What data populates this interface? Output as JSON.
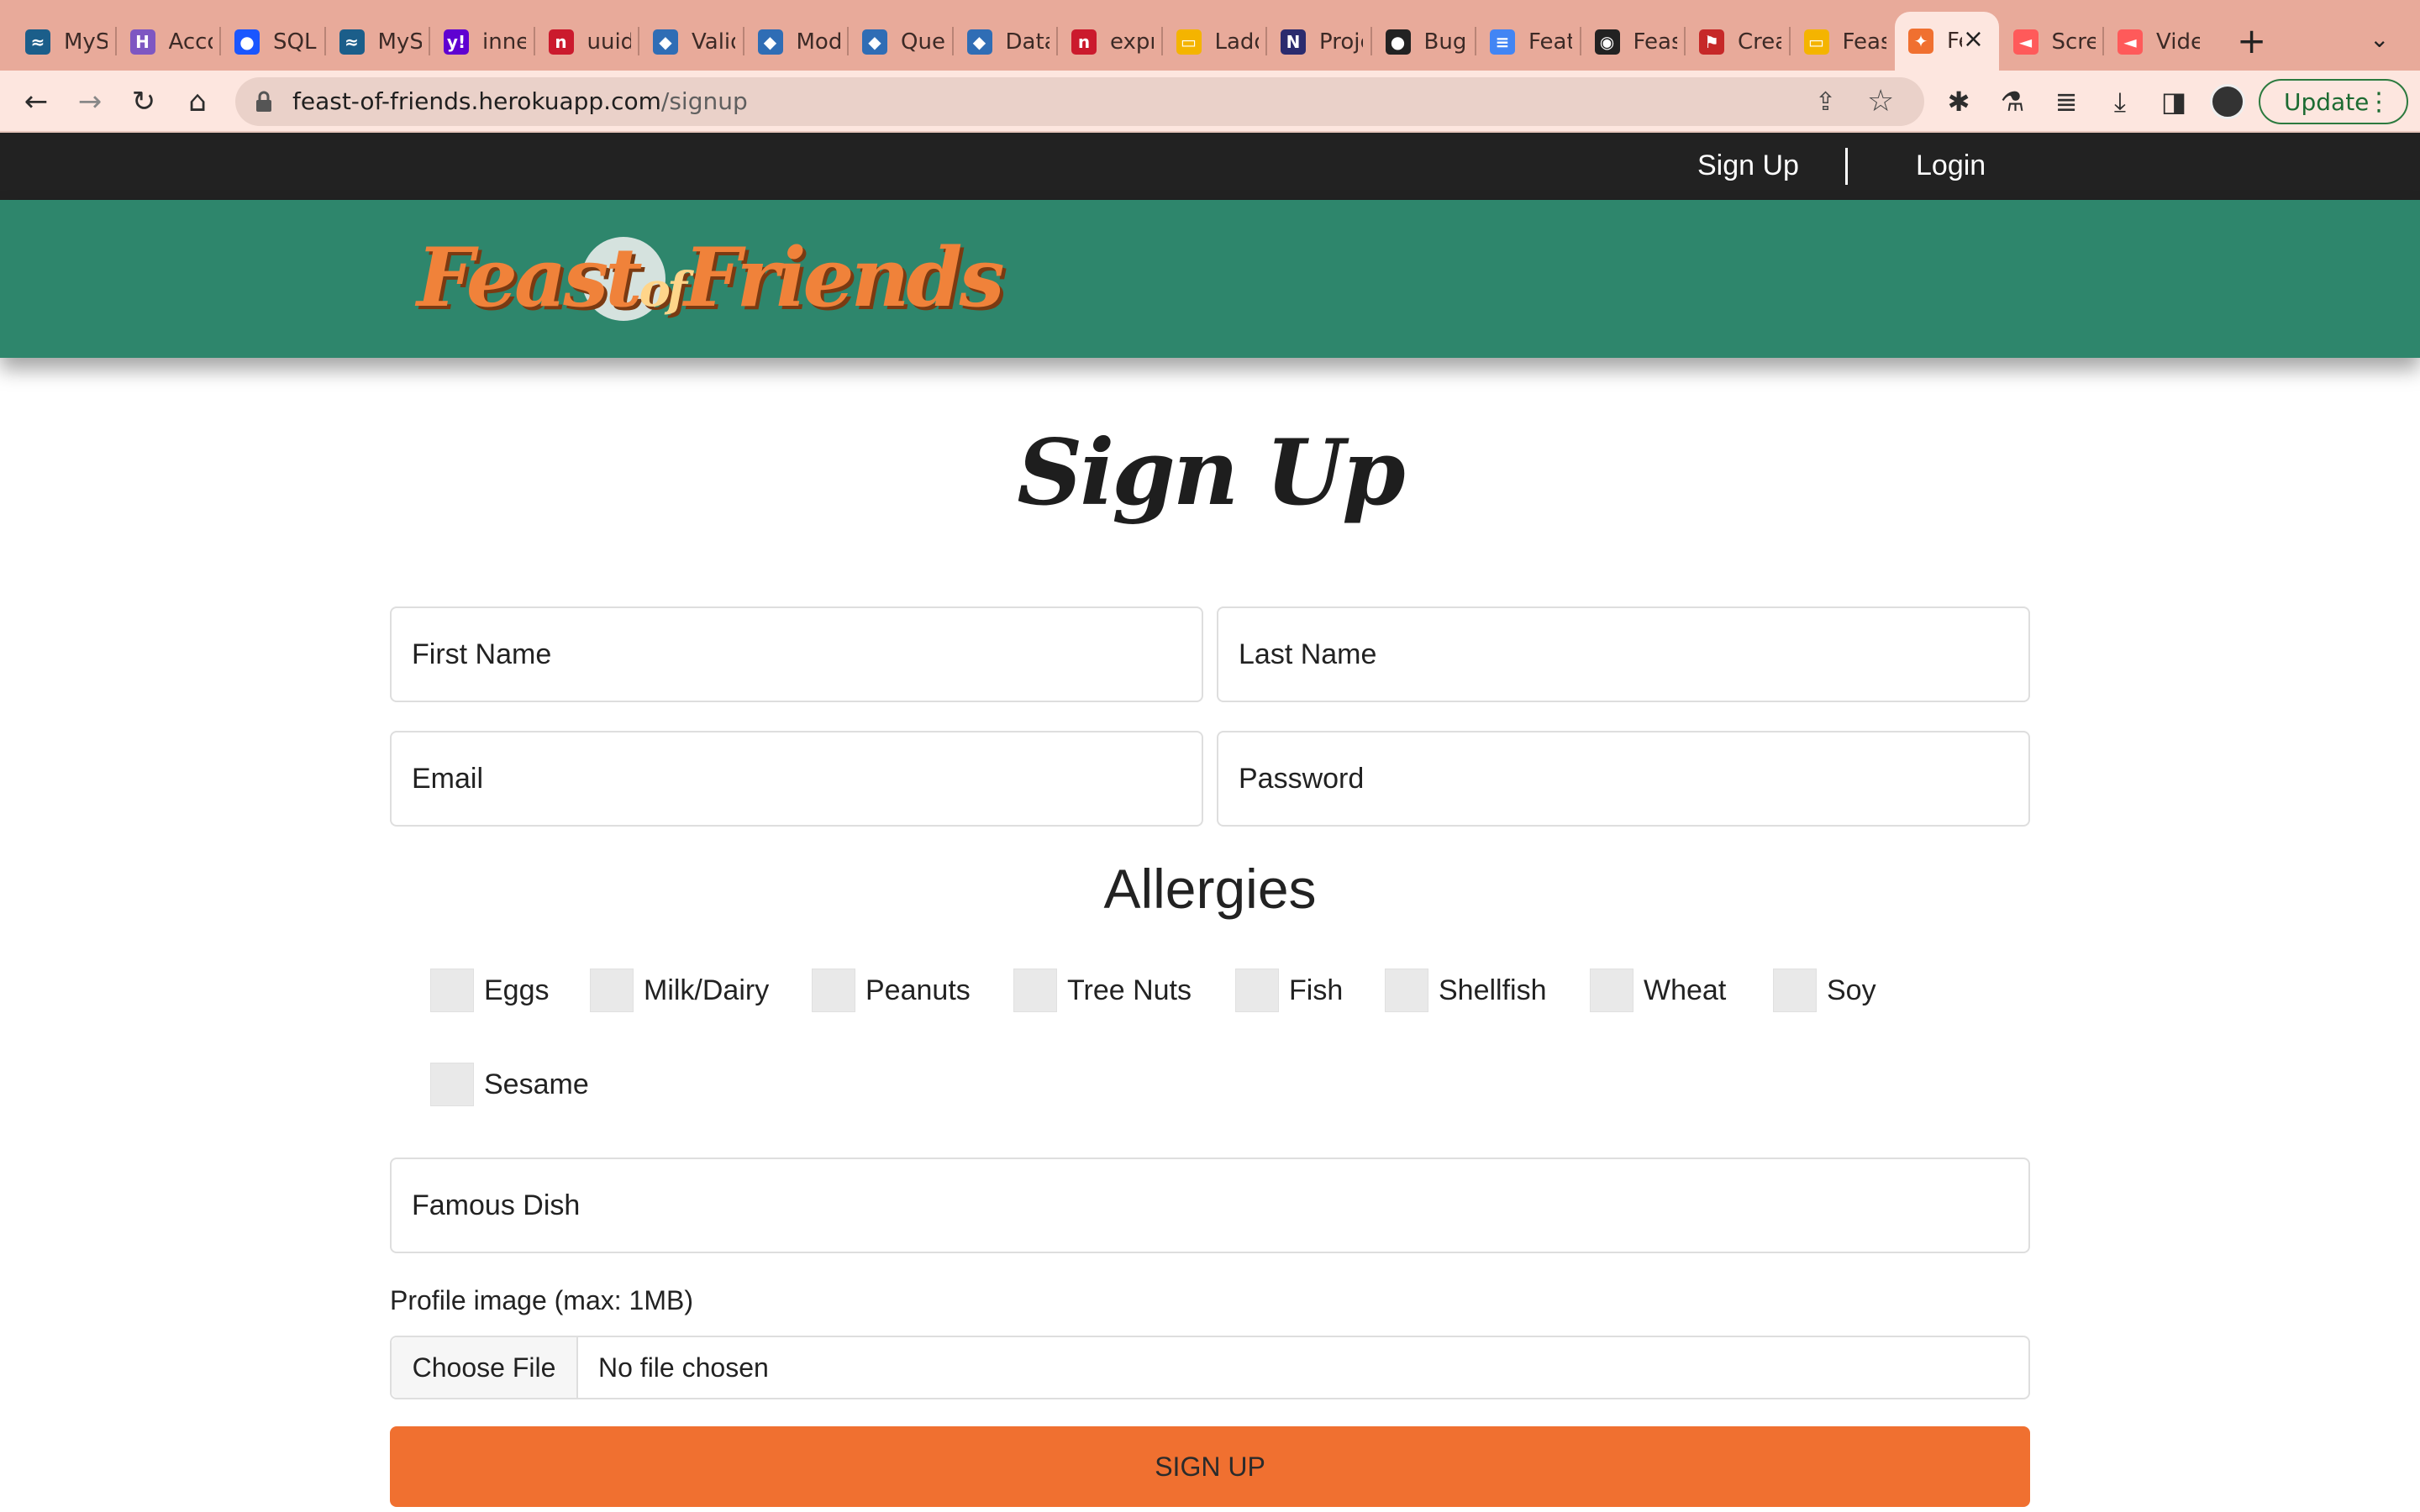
{
  "browser": {
    "tabs": [
      {
        "title": "MySQL",
        "icon": "mysql-icon",
        "color": "#1b5e8a",
        "glyph": "≈"
      },
      {
        "title": "Accounts",
        "icon": "heroku-icon",
        "color": "#7e57c2",
        "glyph": "H"
      },
      {
        "title": "SQL",
        "icon": "blue-dot-icon",
        "color": "#1a56ff",
        "glyph": "●"
      },
      {
        "title": "MySQL",
        "icon": "mysql-icon",
        "color": "#1b5e8a",
        "glyph": "≈"
      },
      {
        "title": "inner",
        "icon": "yahoo-icon",
        "color": "#5f01d1",
        "glyph": "y!"
      },
      {
        "title": "uuid",
        "icon": "npm-icon",
        "color": "#cb1a2d",
        "glyph": "n"
      },
      {
        "title": "Validation",
        "icon": "sequelize-icon",
        "color": "#2f6db5",
        "glyph": "◆"
      },
      {
        "title": "Model",
        "icon": "sequelize-icon",
        "color": "#2f6db5",
        "glyph": "◆"
      },
      {
        "title": "Queries",
        "icon": "sequelize-icon",
        "color": "#2f6db5",
        "glyph": "◆"
      },
      {
        "title": "Data",
        "icon": "sequelize-icon",
        "color": "#2f6db5",
        "glyph": "◆"
      },
      {
        "title": "express",
        "icon": "npm-icon",
        "color": "#cb1a2d",
        "glyph": "n"
      },
      {
        "title": "Ladder",
        "icon": "slides-icon",
        "color": "#f4b400",
        "glyph": "▭"
      },
      {
        "title": "Project",
        "icon": "notion-icon",
        "color": "#2b2b6e",
        "glyph": "N"
      },
      {
        "title": "Bug",
        "icon": "github-icon",
        "color": "#222222",
        "glyph": "●"
      },
      {
        "title": "Feature",
        "icon": "docs-icon",
        "color": "#4285f4",
        "glyph": "≡"
      },
      {
        "title": "Feast",
        "icon": "globe-icon",
        "color": "#222222",
        "glyph": "◉"
      },
      {
        "title": "Create",
        "icon": "flag-icon",
        "color": "#c62828",
        "glyph": "⚑"
      },
      {
        "title": "Feast",
        "icon": "slides-icon",
        "color": "#f4b400",
        "glyph": "▭"
      },
      {
        "title": "Feast of Friends",
        "icon": "feast-icon",
        "color": "#f07030",
        "glyph": "✦",
        "active": true
      },
      {
        "title": "Screencastify",
        "icon": "screencastify-icon",
        "color": "#ff5a5a",
        "glyph": "◄"
      },
      {
        "title": "Video",
        "icon": "screencastify-icon",
        "color": "#ff5a5a",
        "glyph": "◄"
      }
    ],
    "url_host": "feast-of-friends.herokuapp.com",
    "url_path": "/signup",
    "update_label": "Update"
  },
  "nav": {
    "signup": "Sign Up",
    "login": "Login"
  },
  "logo": {
    "part1": "Feast",
    "of": "of",
    "part2": "Friends"
  },
  "form": {
    "title": "Sign Up",
    "first_name": "First Name",
    "last_name": "Last Name",
    "email": "Email",
    "password": "Password",
    "allergies_title": "Allergies",
    "allergies": [
      "Eggs",
      "Milk/Dairy",
      "Peanuts",
      "Tree Nuts",
      "Fish",
      "Shellfish",
      "Wheat",
      "Soy",
      "Sesame"
    ],
    "famous_dish": "Famous Dish",
    "image_label": "Profile image (max: 1MB)",
    "choose_file": "Choose File",
    "no_file": "No file chosen",
    "submit": "SIGN UP"
  },
  "colors": {
    "nav_bg": "#222222",
    "header_green": "#2e866c",
    "accent_orange": "#f07030"
  }
}
